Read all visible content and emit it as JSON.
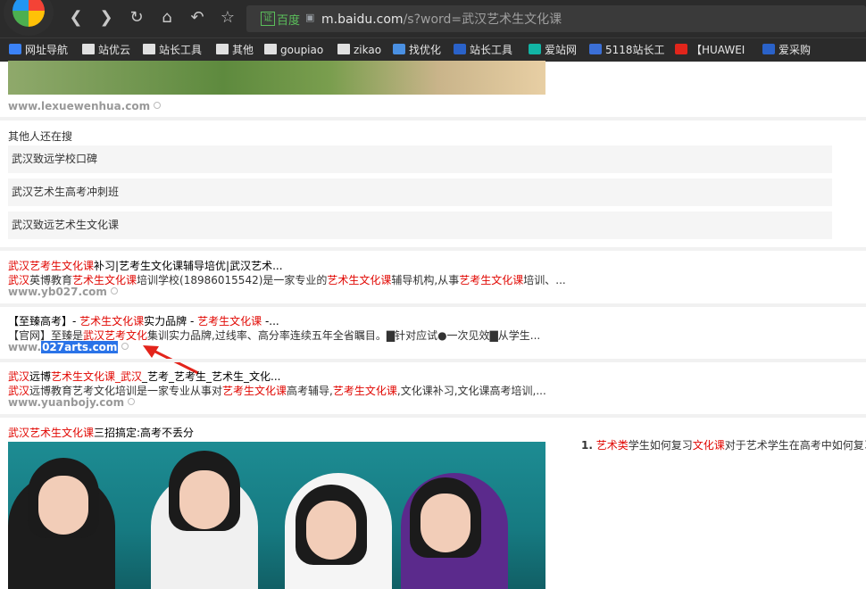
{
  "browser": {
    "address": {
      "site_label": "百度",
      "cert_label": "证",
      "url_host": "m.baidu.com",
      "url_path": "/s?word=武汉艺术生文化课"
    }
  },
  "bookmarks": [
    {
      "label": "网址导航",
      "icon": "globe-icon",
      "color": "#3b82f6"
    },
    {
      "label": "站优云",
      "icon": "folder-icon",
      "color": "#e0e0e0"
    },
    {
      "label": "站长工具",
      "icon": "folder-icon",
      "color": "#e0e0e0"
    },
    {
      "label": "其他",
      "icon": "folder-icon",
      "color": "#e0e0e0"
    },
    {
      "label": "goupiao",
      "icon": "folder-icon",
      "color": "#e0e0e0"
    },
    {
      "label": "zikao",
      "icon": "folder-icon",
      "color": "#e0e0e0"
    },
    {
      "label": "找优化",
      "icon": "chart-icon",
      "color": "#4a90e2"
    },
    {
      "label": "站长工具",
      "icon": "tool-icon",
      "color": "#2a62c9"
    },
    {
      "label": "爱站网",
      "icon": "crop-icon",
      "color": "#12b5a5"
    },
    {
      "label": "5118站长工",
      "icon": "s-icon",
      "color": "#3b6fd6"
    },
    {
      "label": "【HUAWEI",
      "icon": "huawei-icon",
      "color": "#e1251b"
    },
    {
      "label": "爱采购",
      "icon": "grid-icon",
      "color": "#2a62c9"
    }
  ],
  "result_top": {
    "source": "www.lexuewenhua.com"
  },
  "others": {
    "title": "其他人还在搜",
    "items": [
      "武汉致远学校口碑",
      "武汉艺术生高考冲刺班",
      "武汉致远艺术生文化课"
    ]
  },
  "results": [
    {
      "title_parts": [
        [
          "hl",
          "武汉艺考生文化课"
        ],
        [
          "n",
          "补习|艺考生文化课辅导培优|武汉艺术..."
        ]
      ],
      "desc_parts": [
        [
          "hl",
          "武汉"
        ],
        [
          "n",
          "英博教育"
        ],
        [
          "hl",
          "艺术生文化课"
        ],
        [
          "n",
          "培训学校(18986015542)是一家专业的"
        ],
        [
          "hl",
          "艺术生文化课"
        ],
        [
          "n",
          "辅导机构,从事"
        ],
        [
          "hl",
          "艺考生文化课"
        ],
        [
          "n",
          "培训、..."
        ]
      ],
      "source": "www.yb027.com"
    },
    {
      "title_parts": [
        [
          "n",
          "【至臻高考】- "
        ],
        [
          "hl",
          "艺术生文化课"
        ],
        [
          "n",
          "实力品牌 - "
        ],
        [
          "hl",
          "艺考生文化课"
        ],
        [
          "n",
          " -..."
        ]
      ],
      "desc_parts": [
        [
          "n",
          "【官网】至臻是"
        ],
        [
          "hl",
          "武汉艺考文化"
        ],
        [
          "n",
          "集训实力品牌,过线率、高分率连续五年全省瞩目。▇针对应试●一次见效▇从学生..."
        ]
      ],
      "source_prefix": "www.",
      "source_selected": "027arts.com"
    },
    {
      "title_parts": [
        [
          "hl",
          "武汉"
        ],
        [
          "n",
          "远博"
        ],
        [
          "hl",
          "艺术生文化课_武汉"
        ],
        [
          "n",
          "_艺考_艺考生_艺术生_文化..."
        ]
      ],
      "desc_parts": [
        [
          "hl",
          "武汉"
        ],
        [
          "n",
          "远博教育艺考文化培训是一家专业从事对"
        ],
        [
          "hl",
          "艺考生文化课"
        ],
        [
          "n",
          "高考辅导,"
        ],
        [
          "hl",
          "艺考生文化课"
        ],
        [
          "n",
          ",文化课补习,文化课高考培训,..."
        ]
      ],
      "source": "www.yuanbojy.com"
    },
    {
      "title_parts": [
        [
          "hl",
          "武汉艺术生文化课"
        ],
        [
          "n",
          "三招搞定:高考不丢分"
        ]
      ]
    }
  ],
  "sidebar": {
    "number": "1.",
    "text_parts": [
      [
        "hl",
        "艺术类"
      ],
      [
        "n",
        "学生如何复习"
      ],
      [
        "hl",
        "文化课"
      ],
      [
        "n",
        "对于艺术学生在高考中如何复习"
      ]
    ]
  }
}
